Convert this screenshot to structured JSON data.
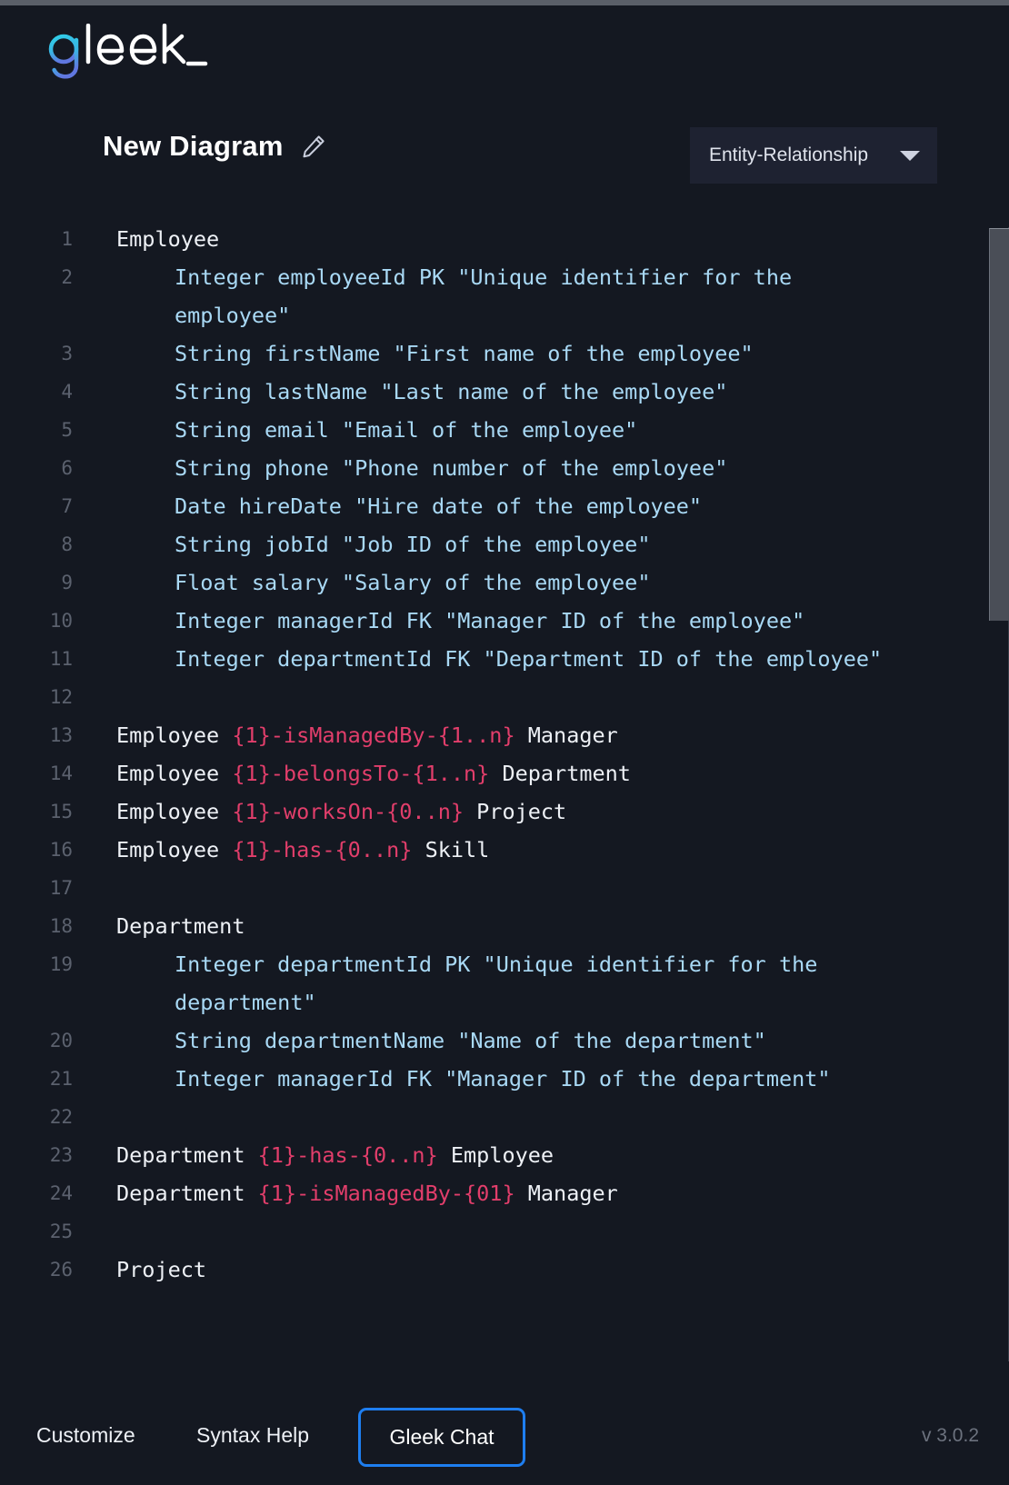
{
  "app": {
    "logo_text": "gleek_",
    "logo_accent_color": "#33c8e0",
    "logo_accent_color2": "#5b7ae8",
    "logo_text_color": "#ffffff",
    "version": "v 3.0.2"
  },
  "header": {
    "title": "New Diagram",
    "edit_icon": "pencil-icon",
    "diagram_type": "Entity-Relationship",
    "dropdown_icon": "chevron-down-icon"
  },
  "editor": {
    "colors": {
      "background": "#141821",
      "line_number": "#5b616e",
      "entity": "#eef1f6",
      "attribute": "#a9d9f5",
      "relationship": "#e23e6b"
    },
    "lines": [
      {
        "n": "1",
        "indent": false,
        "tokens": [
          {
            "t": "Employee",
            "c": "entity"
          }
        ]
      },
      {
        "n": "2",
        "indent": true,
        "tokens": [
          {
            "t": "Integer employeeId PK \"Unique identifier for the employee\"",
            "c": "attr"
          }
        ]
      },
      {
        "n": "3",
        "indent": true,
        "tokens": [
          {
            "t": "String firstName \"First name of the employee\"",
            "c": "attr"
          }
        ]
      },
      {
        "n": "4",
        "indent": true,
        "tokens": [
          {
            "t": "String lastName \"Last name of the employee\"",
            "c": "attr"
          }
        ]
      },
      {
        "n": "5",
        "indent": true,
        "tokens": [
          {
            "t": "String email \"Email of the employee\"",
            "c": "attr"
          }
        ]
      },
      {
        "n": "6",
        "indent": true,
        "tokens": [
          {
            "t": "String phone \"Phone number of the employee\"",
            "c": "attr"
          }
        ]
      },
      {
        "n": "7",
        "indent": true,
        "tokens": [
          {
            "t": "Date hireDate \"Hire date of the employee\"",
            "c": "attr"
          }
        ]
      },
      {
        "n": "8",
        "indent": true,
        "tokens": [
          {
            "t": "String jobId \"Job ID of the employee\"",
            "c": "attr"
          }
        ]
      },
      {
        "n": "9",
        "indent": true,
        "tokens": [
          {
            "t": "Float salary \"Salary of the employee\"",
            "c": "attr"
          }
        ]
      },
      {
        "n": "10",
        "indent": true,
        "tokens": [
          {
            "t": "Integer managerId FK \"Manager ID of the employee\"",
            "c": "attr"
          }
        ]
      },
      {
        "n": "11",
        "indent": true,
        "tokens": [
          {
            "t": "Integer departmentId FK \"Department ID of the employee\"",
            "c": "attr"
          }
        ]
      },
      {
        "n": "12",
        "indent": false,
        "tokens": []
      },
      {
        "n": "13",
        "indent": false,
        "tokens": [
          {
            "t": "Employee ",
            "c": "entity"
          },
          {
            "t": "{1}-isManagedBy-{1..n}",
            "c": "rel"
          },
          {
            "t": " Manager",
            "c": "entity"
          }
        ]
      },
      {
        "n": "14",
        "indent": false,
        "tokens": [
          {
            "t": "Employee ",
            "c": "entity"
          },
          {
            "t": "{1}-belongsTo-{1..n}",
            "c": "rel"
          },
          {
            "t": " Department",
            "c": "entity"
          }
        ]
      },
      {
        "n": "15",
        "indent": false,
        "tokens": [
          {
            "t": "Employee ",
            "c": "entity"
          },
          {
            "t": "{1}-worksOn-{0..n}",
            "c": "rel"
          },
          {
            "t": " Project",
            "c": "entity"
          }
        ]
      },
      {
        "n": "16",
        "indent": false,
        "tokens": [
          {
            "t": "Employee ",
            "c": "entity"
          },
          {
            "t": "{1}-has-{0..n}",
            "c": "rel"
          },
          {
            "t": " Skill",
            "c": "entity"
          }
        ]
      },
      {
        "n": "17",
        "indent": false,
        "tokens": []
      },
      {
        "n": "18",
        "indent": false,
        "tokens": [
          {
            "t": "Department",
            "c": "entity"
          }
        ]
      },
      {
        "n": "19",
        "indent": true,
        "tokens": [
          {
            "t": "Integer departmentId PK \"Unique identifier for the department\"",
            "c": "attr"
          }
        ]
      },
      {
        "n": "20",
        "indent": true,
        "tokens": [
          {
            "t": "String departmentName \"Name of the department\"",
            "c": "attr"
          }
        ]
      },
      {
        "n": "21",
        "indent": true,
        "tokens": [
          {
            "t": "Integer managerId FK \"Manager ID of the department\"",
            "c": "attr"
          }
        ]
      },
      {
        "n": "22",
        "indent": false,
        "tokens": []
      },
      {
        "n": "23",
        "indent": false,
        "tokens": [
          {
            "t": "Department ",
            "c": "entity"
          },
          {
            "t": "{1}-has-{0..n}",
            "c": "rel"
          },
          {
            "t": " Employee",
            "c": "entity"
          }
        ]
      },
      {
        "n": "24",
        "indent": false,
        "tokens": [
          {
            "t": "Department ",
            "c": "entity"
          },
          {
            "t": "{1}-isManagedBy-{01}",
            "c": "rel"
          },
          {
            "t": " Manager",
            "c": "entity"
          }
        ]
      },
      {
        "n": "25",
        "indent": false,
        "tokens": []
      },
      {
        "n": "26",
        "indent": false,
        "tokens": [
          {
            "t": "Project",
            "c": "entity"
          }
        ]
      }
    ]
  },
  "bottom_bar": {
    "customize": "Customize",
    "syntax_help": "Syntax Help",
    "gleek_chat": "Gleek Chat",
    "gleek_chat_border_color": "#1e7ef0",
    "version": "v 3.0.2"
  }
}
